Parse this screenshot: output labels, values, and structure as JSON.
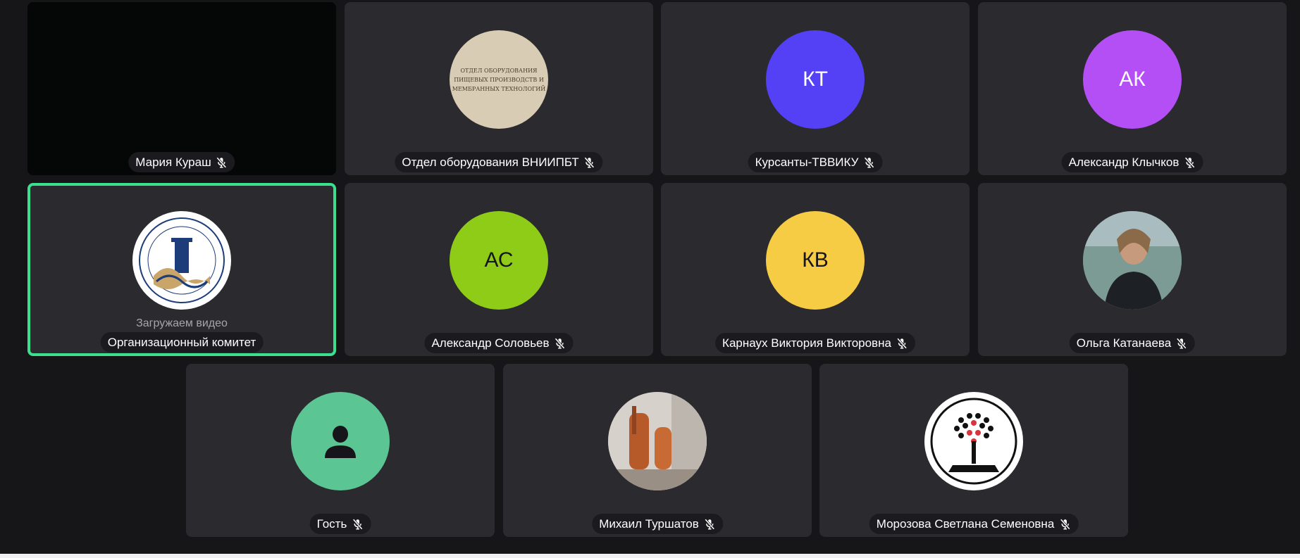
{
  "loading_text": "Загружаем видео",
  "participants": [
    {
      "name": "Мария Кураш",
      "muted": true
    },
    {
      "name": "Отдел оборудования ВНИИПБТ",
      "muted": true,
      "avatar_text": [
        "ОТДЕЛ ОБОРУДОВАНИЯ",
        "ПИЩЕВЫХ ПРОИЗВОДСТВ И",
        "МЕМБРАННЫХ ТЕХНОЛОГИЙ"
      ]
    },
    {
      "name": "Курсанты-ТВВИКУ",
      "muted": true,
      "initials": "КТ",
      "color": "#5541f5"
    },
    {
      "name": "Александр Клычков",
      "muted": true,
      "initials": "АК",
      "color": "#b44ef5"
    },
    {
      "name": "Организационный комитет",
      "muted": false,
      "active": true
    },
    {
      "name": "Александр Соловьев",
      "muted": true,
      "initials": "АС",
      "color": "#8fcc18"
    },
    {
      "name": "Карнаух Виктория Викторовна",
      "muted": true,
      "initials": "КВ",
      "color": "#f7cc45"
    },
    {
      "name": "Ольга Катанаева",
      "muted": true
    },
    {
      "name": "Гость",
      "muted": true,
      "color": "#5bc594"
    },
    {
      "name": "Михаил Туршатов",
      "muted": true
    },
    {
      "name": "Морозова Светлана Семеновна",
      "muted": true
    }
  ]
}
